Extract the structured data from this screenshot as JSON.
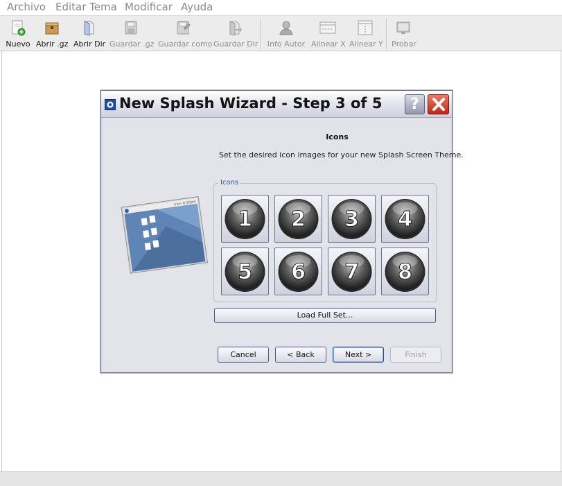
{
  "menubar": {
    "items": [
      "Archivo",
      "Editar Tema",
      "Modificar",
      "Ayuda"
    ]
  },
  "toolbar": {
    "buttons": [
      {
        "label": "Nuevo",
        "icon": "new-document-icon",
        "enabled": true
      },
      {
        "label": "Abrir .gz",
        "icon": "open-archive-icon",
        "enabled": true
      },
      {
        "label": "Abrir Dir",
        "icon": "open-directory-icon",
        "enabled": true
      },
      {
        "label": "Guardar .gz",
        "icon": "save-archive-icon",
        "enabled": false
      },
      {
        "label": "Guardar como",
        "icon": "save-as-icon",
        "enabled": false
      },
      {
        "label": "Guardar Dir",
        "icon": "save-directory-icon",
        "enabled": false
      },
      {
        "label": "Info Autor",
        "icon": "author-icon",
        "enabled": false
      },
      {
        "label": "Alinear X",
        "icon": "align-x-icon",
        "enabled": false
      },
      {
        "label": "Alinear Y",
        "icon": "align-y-icon",
        "enabled": false
      },
      {
        "label": "Probar",
        "icon": "test-icon",
        "enabled": false
      }
    ]
  },
  "dialog": {
    "title": "New Splash Wizard - Step 3 of 5",
    "help_symbol": "?",
    "heading": "Icons",
    "description": "Set the desired icon images for your new Splash Screen Theme.",
    "group_label": "Icons",
    "icons": [
      "1",
      "2",
      "3",
      "4",
      "5",
      "6",
      "7",
      "8"
    ],
    "load_full_set": "Load Full Set...",
    "buttons": {
      "cancel": "Cancel",
      "back": "< Back",
      "next": "Next >",
      "finish": "Finish"
    },
    "preview_clock": "mon 8:30pm"
  },
  "colors": {
    "accent_blue": "#2d55b8",
    "close_red": "#c22414",
    "dialog_bg": "#e3e3ea"
  }
}
